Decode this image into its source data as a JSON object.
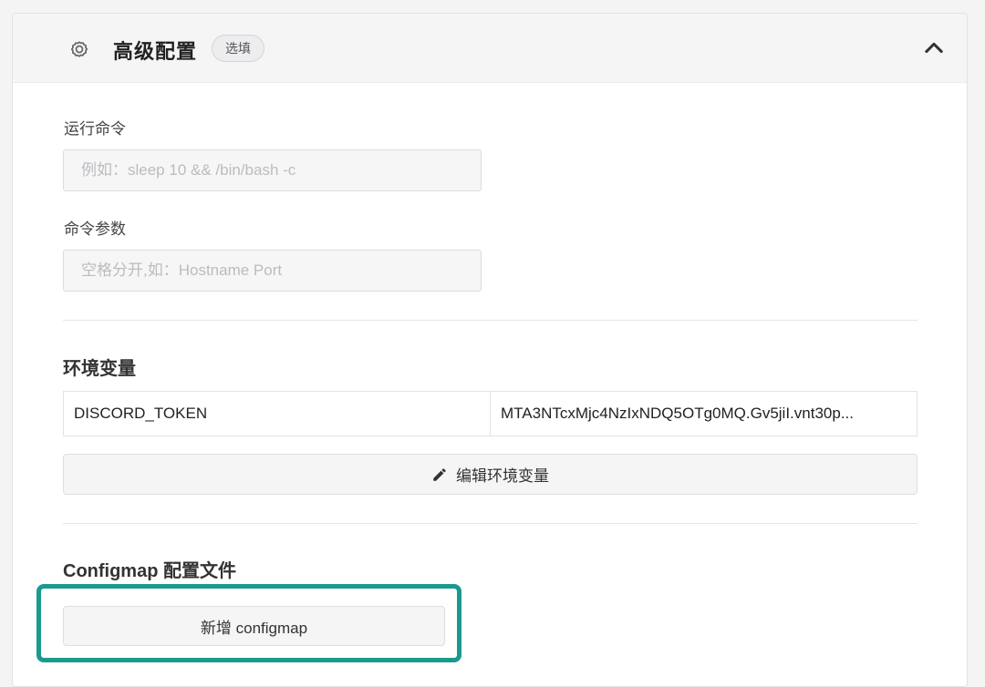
{
  "header": {
    "title": "高级配置",
    "badge": "选填",
    "settings_icon": "gear-icon",
    "collapse_icon": "chevron-up-icon"
  },
  "fields": {
    "run_command": {
      "label": "运行命令",
      "value": "",
      "placeholder": "例如：sleep 10 && /bin/bash -c"
    },
    "command_args": {
      "label": "命令参数",
      "value": "",
      "placeholder": "空格分开,如：Hostname Port"
    }
  },
  "env": {
    "title": "环境变量",
    "rows": [
      {
        "key": "DISCORD_TOKEN",
        "value": "MTA3NTcxMjc4NzIxNDQ5OTg0MQ.Gv5jiI.vnt30p..."
      }
    ],
    "edit_button": "编辑环境变量",
    "edit_icon": "pencil-icon"
  },
  "configmap": {
    "title": "Configmap 配置文件",
    "add_button": "新增 configmap"
  },
  "colors": {
    "highlight": "#1a9a8e"
  }
}
